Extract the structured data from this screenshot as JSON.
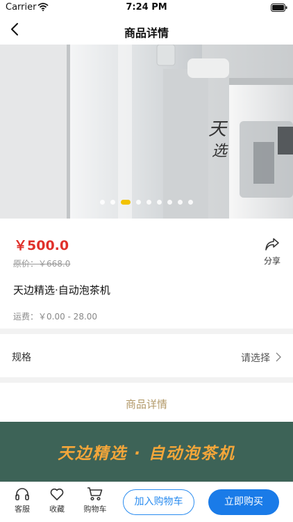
{
  "status_bar": {
    "carrier": "Carrier",
    "time": "7:24 PM"
  },
  "nav": {
    "title": "商品详情"
  },
  "carousel": {
    "dot_count": 9,
    "active_index": 2
  },
  "product": {
    "price": "￥500.0",
    "original_price": "原价：￥668.0",
    "share_label": "分享",
    "name": "天边精选·自动泡茶机",
    "shipping": "运费：￥0.00 - 28.00"
  },
  "spec": {
    "label": "规格",
    "value": "请选择"
  },
  "detail": {
    "title": "商品详情",
    "banner_text": "天边精选 · 自动泡茶机"
  },
  "bottom_bar": {
    "service_label": "客服",
    "favorite_label": "收藏",
    "cart_label": "购物车",
    "add_to_cart_label": "加入购物车",
    "buy_now_label": "立即购买"
  },
  "colors": {
    "price": "#e0312b",
    "accent": "#1a7be8",
    "detail_title": "#b39a6a",
    "banner_bg": "#3d6357",
    "banner_text": "#f4a63a",
    "active_dot": "#f2c200"
  }
}
